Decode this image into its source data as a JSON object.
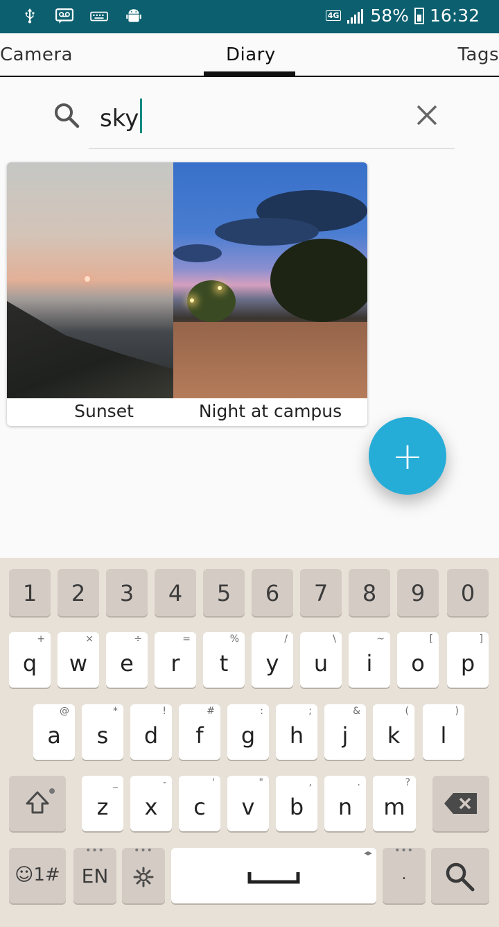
{
  "status_bar": {
    "icons_left": [
      "usb-icon",
      "voicemail-icon",
      "keyboard-icon",
      "android-icon"
    ],
    "network": "4G",
    "battery_percent": "58%",
    "time": "16:32"
  },
  "tabs": [
    {
      "label": "Camera",
      "selected": false
    },
    {
      "label": "Diary",
      "selected": true
    },
    {
      "label": "Tags",
      "selected": false
    }
  ],
  "search": {
    "value": "sky"
  },
  "results": [
    {
      "caption": "Sunset"
    },
    {
      "caption": "Night at campus"
    }
  ],
  "fab": {
    "label": "+"
  },
  "keyboard": {
    "number_row": [
      "1",
      "2",
      "3",
      "4",
      "5",
      "6",
      "7",
      "8",
      "9",
      "0"
    ],
    "row1": [
      {
        "key": "q",
        "hint": "+"
      },
      {
        "key": "w",
        "hint": "×"
      },
      {
        "key": "e",
        "hint": "÷"
      },
      {
        "key": "r",
        "hint": "="
      },
      {
        "key": "t",
        "hint": "%"
      },
      {
        "key": "y",
        "hint": "/"
      },
      {
        "key": "u",
        "hint": "\\"
      },
      {
        "key": "i",
        "hint": "~"
      },
      {
        "key": "o",
        "hint": "["
      },
      {
        "key": "p",
        "hint": "]"
      }
    ],
    "row2": [
      {
        "key": "a",
        "hint": "@"
      },
      {
        "key": "s",
        "hint": "*"
      },
      {
        "key": "d",
        "hint": "!"
      },
      {
        "key": "f",
        "hint": "#"
      },
      {
        "key": "g",
        "hint": ":"
      },
      {
        "key": "h",
        "hint": ";"
      },
      {
        "key": "j",
        "hint": "&"
      },
      {
        "key": "k",
        "hint": "("
      },
      {
        "key": "l",
        "hint": ")"
      }
    ],
    "row3": [
      {
        "key": "z",
        "hint": "_"
      },
      {
        "key": "x",
        "hint": "-"
      },
      {
        "key": "c",
        "hint": "'"
      },
      {
        "key": "v",
        "hint": "\""
      },
      {
        "key": "b",
        "hint": ","
      },
      {
        "key": "n",
        "hint": "."
      },
      {
        "key": "m",
        "hint": "?"
      }
    ],
    "bottom": {
      "symbols": "☺1#",
      "language": "EN",
      "period": "."
    }
  },
  "colors": {
    "status_bar": "#0b5f6e",
    "fab": "#26add7",
    "caret": "#0e8a80",
    "keyboard_bg": "#e8e1d8"
  }
}
